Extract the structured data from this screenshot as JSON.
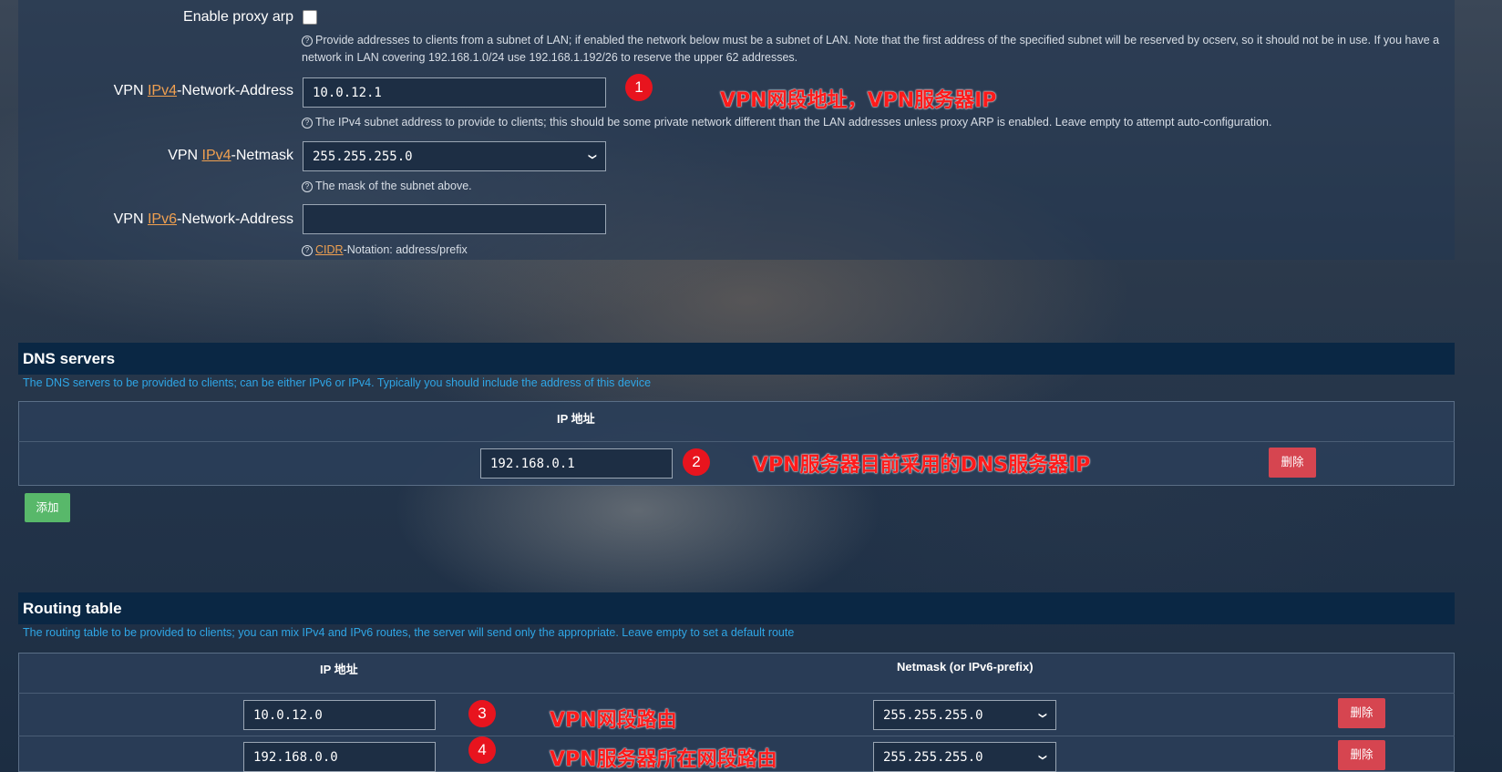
{
  "proxy": {
    "enable_label": "Enable proxy arp",
    "enable_help": "Provide addresses to clients from a subnet of LAN; if enabled the network below must be a subnet of LAN. Note that the first address of the specified subnet will be reserved by ocserv, so it should not be in use. If you have a network in LAN covering 192.168.1.0/24 use 192.168.1.192/26 to reserve the upper 62 addresses.",
    "ipv4_addr_label_pre": "VPN ",
    "ipv4_link": "IPv4",
    "ipv4_addr_label_post": "-Network-Address",
    "ipv4_addr_value": "10.0.12.1",
    "ipv4_addr_help": "The IPv4 subnet address to provide to clients; this should be some private network different than the LAN addresses unless proxy ARP is enabled. Leave empty to attempt auto-configuration.",
    "netmask_label_pre": "VPN ",
    "netmask_link": "IPv4",
    "netmask_label_post": "-Netmask",
    "netmask_value": "255.255.255.0",
    "netmask_help": "The mask of the subnet above.",
    "ipv6_label_pre": "VPN ",
    "ipv6_link": "IPv6",
    "ipv6_label_post": "-Network-Address",
    "ipv6_value": "",
    "ipv6_help_link": "CIDR",
    "ipv6_help_post": "-Notation: address/prefix"
  },
  "annotations": {
    "a1": "1",
    "a1_text": "VPN网段地址，VPN服务器IP",
    "a2": "2",
    "a2_text": "VPN服务器目前采用的DNS服务器IP",
    "a3": "3",
    "a3_text": "VPN网段路由",
    "a4": "4",
    "a4_text": "VPN服务器所在网段路由"
  },
  "dns": {
    "title": "DNS servers",
    "desc": "The DNS servers to be provided to clients; can be either IPv6 or IPv4. Typically you should include the address of this device",
    "col_ip": "IP 地址",
    "rows": [
      {
        "ip": "192.168.0.1",
        "delete": "删除"
      }
    ],
    "add": "添加"
  },
  "routing": {
    "title": "Routing table",
    "desc": "The routing table to be provided to clients; you can mix IPv4 and IPv6 routes, the server will send only the appropriate. Leave empty to set a default route",
    "col_ip": "IP 地址",
    "col_mask": "Netmask (or IPv6-prefix)",
    "rows": [
      {
        "ip": "10.0.12.0",
        "mask": "255.255.255.0",
        "delete": "删除"
      },
      {
        "ip": "192.168.0.0",
        "mask": "255.255.255.0",
        "delete": "删除"
      }
    ]
  },
  "icons": {
    "help": "help-circle-icon",
    "select": "chevron-down-icon"
  },
  "colors": {
    "link": "#f0a050",
    "desc": "#2fa6e6",
    "delete": "#d64550",
    "add": "#58b86a",
    "annotation": "#e8141e"
  }
}
